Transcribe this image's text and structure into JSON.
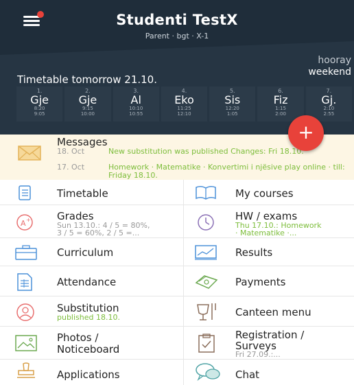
{
  "header": {
    "title": "Studenti TestX",
    "subtitle": "Parent · bgt · X-1",
    "hooray": "hooray",
    "weekend": "weekend",
    "timetable_title": "Timetable tomorrow 21.10.",
    "days": [
      {
        "num": "1.",
        "subject": "Gje",
        "start": "8:20",
        "end": "9:05"
      },
      {
        "num": "2.",
        "subject": "Gje",
        "start": "9:15",
        "end": "10:00"
      },
      {
        "num": "3.",
        "subject": "Al",
        "start": "10:10",
        "end": "10:55"
      },
      {
        "num": "4.",
        "subject": "Eko",
        "start": "11:25",
        "end": "12:10"
      },
      {
        "num": "5.",
        "subject": "Sis",
        "start": "12:20",
        "end": "1:05"
      },
      {
        "num": "6.",
        "subject": "Fiz",
        "start": "1:15",
        "end": "2:00"
      },
      {
        "num": "7.",
        "subject": "Gj.",
        "start": "2:10",
        "end": "2:55"
      }
    ],
    "fab_label": "+"
  },
  "messages": {
    "title": "Messages",
    "items": [
      {
        "date": "18. Oct",
        "text": "New substitution was published Changes: Fri 18.10."
      },
      {
        "date": "17. Oct",
        "text": "Homework · Matematike · Konvertimi i njësive play online · till: Friday 18.10."
      }
    ]
  },
  "menu": {
    "timetable": {
      "label": "Timetable"
    },
    "my_courses": {
      "label": "My courses"
    },
    "grades": {
      "label": "Grades",
      "sub1": "Sun 13.10.: 4 / 5 = 80%,",
      "sub2": "3 / 5 = 60%, 2 / 5 =..."
    },
    "hw_exams": {
      "label": "HW / exams",
      "sub1": "Thu 17.10.: Homework",
      "sub2": "· Matematike ·..."
    },
    "curriculum": {
      "label": "Curriculum"
    },
    "results": {
      "label": "Results"
    },
    "attendance": {
      "label": "Attendance"
    },
    "payments": {
      "label": "Payments"
    },
    "substitution": {
      "label": "Substitution",
      "sub": "published 18.10."
    },
    "canteen": {
      "label": "Canteen menu"
    },
    "photos": {
      "label1": "Photos /",
      "label2": "Noticeboard"
    },
    "registration": {
      "label1": "Registration /",
      "label2": "Surveys",
      "sub": "Fri 27.09.:..."
    },
    "applications": {
      "label": "Applications"
    },
    "chat": {
      "label": "Chat"
    }
  },
  "colors": {
    "header_bg": "#1f2d3a",
    "accent_red": "#e8423a",
    "green_text": "#7cbd3a",
    "messages_bg": "#fdf6e4"
  }
}
